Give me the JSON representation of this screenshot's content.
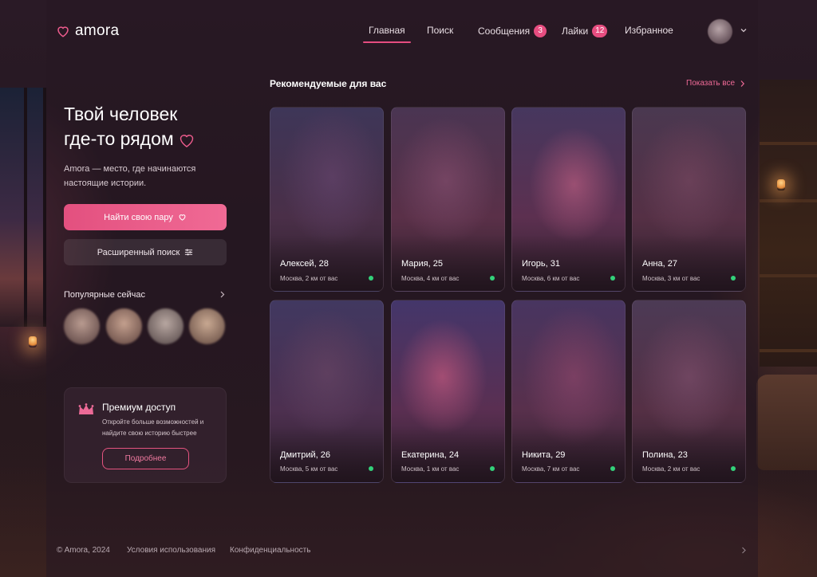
{
  "app": {
    "logo_text": "amora",
    "accent_color": "#e64d80",
    "online_color": "#33d17a"
  },
  "nav": {
    "items": [
      {
        "label": "Главная",
        "active": true
      },
      {
        "label": "Поиск"
      },
      {
        "label": "Сообщения",
        "badge": "3"
      },
      {
        "label": "Лайки",
        "badge": "12"
      },
      {
        "label": "Избранное"
      }
    ],
    "avatar_icon": "user-avatar",
    "menu_icon": "chevron-down-icon"
  },
  "hero": {
    "title_line1": "Твой человек",
    "title_line2": "где-то рядом",
    "subtitle": "Amora — место, где начинаются настоящие истории.",
    "primary_button": "Найти свою пару",
    "secondary_button": "Расширенный поиск"
  },
  "popular": {
    "title": "Популярные сейчас"
  },
  "premium": {
    "title": "Премиум доступ",
    "text": "Откройте больше возможностей и найдите свою историю быстрее",
    "button": "Подробнее"
  },
  "recommendations": {
    "title": "Рекомендуемые для вас",
    "show_all": "Показать все",
    "cards": [
      {
        "name": "Алексей, 28",
        "meta": "Москва, 2 км от вас"
      },
      {
        "name": "Мария, 25",
        "meta": "Москва, 4 км от вас"
      },
      {
        "name": "Игорь, 31",
        "meta": "Москва, 6 км от вас"
      },
      {
        "name": "Анна, 27",
        "meta": "Москва, 3 км от вас"
      },
      {
        "name": "Дмитрий, 26",
        "meta": "Москва, 5 км от вас"
      },
      {
        "name": "Екатерина, 24",
        "meta": "Москва, 1 км от вас"
      },
      {
        "name": "Никита, 29",
        "meta": "Москва, 7 км от вас"
      },
      {
        "name": "Полина, 23",
        "meta": "Москва, 2 км от вас"
      }
    ]
  },
  "footer": {
    "copyright": "© Amora, 2024",
    "terms": "Условия использования",
    "privacy": "Конфиденциальность"
  }
}
